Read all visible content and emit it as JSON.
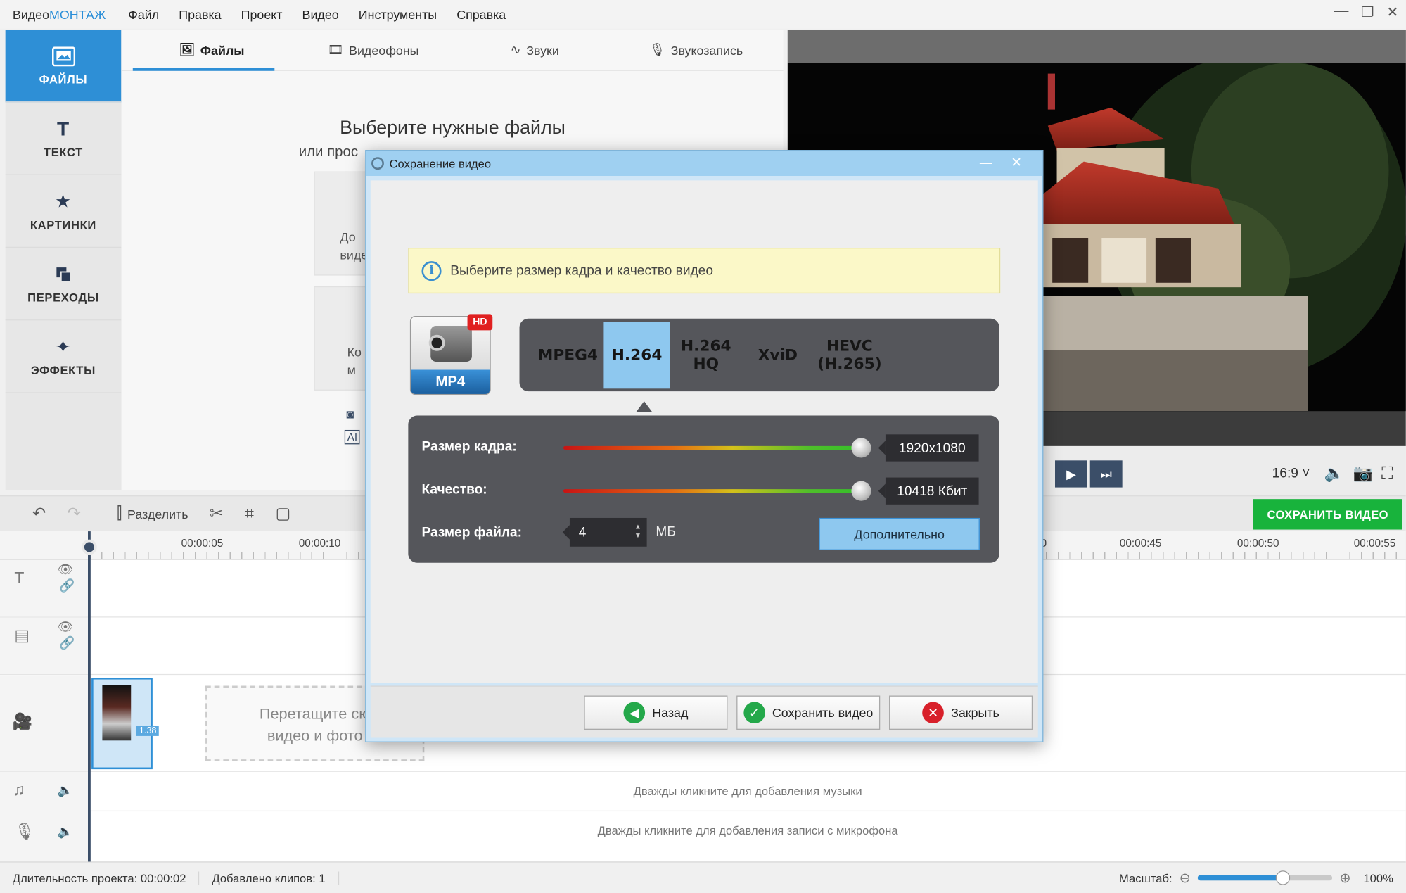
{
  "app": {
    "brand_prefix": "Видео",
    "brand_suffix": "МОНТАЖ"
  },
  "menu": [
    "Файл",
    "Правка",
    "Проект",
    "Видео",
    "Инструменты",
    "Справка"
  ],
  "sidebar": {
    "items": [
      {
        "label": "ФАЙЛЫ",
        "icon": "files-icon"
      },
      {
        "label": "ТЕКСТ",
        "icon": "text-icon"
      },
      {
        "label": "КАРТИНКИ",
        "icon": "star-icon"
      },
      {
        "label": "ПЕРЕХОДЫ",
        "icon": "transitions-icon"
      },
      {
        "label": "ЭФФЕКТЫ",
        "icon": "magic-wand-icon"
      }
    ]
  },
  "library": {
    "tabs": [
      "Файлы",
      "Видеофоны",
      "Звуки",
      "Звукозапись"
    ],
    "title": "Выберите нужные файлы",
    "subtitle": "или прос",
    "card1": "До\nвиде",
    "card2": "Ко\nм"
  },
  "preview": {
    "aspect": "16:9"
  },
  "toolbar": {
    "split_label": "Разделить",
    "save_video": "СОХРАНИТЬ ВИДЕО"
  },
  "ruler": {
    "times": [
      "00:00:05",
      "00:00:10",
      "0",
      "00:00:45",
      "00:00:50",
      "00:00:55"
    ]
  },
  "tracks": {
    "clip_duration": "1.38",
    "drop_hint": "Перетащите сю\nвидео и фото",
    "music_hint": "Дважды кликните для добавления музыки",
    "mic_hint": "Дважды кликните для добавления записи с микрофона"
  },
  "status": {
    "duration_label": "Длительность проекта:",
    "duration_value": "00:00:02",
    "clips_label": "Добавлено клипов:",
    "clips_value": "1",
    "zoom_label": "Масштаб:",
    "zoom_value": "100%",
    "zoom_level": 0.65
  },
  "dialog": {
    "title": "Сохранение видео",
    "info": "Выберите размер кадра и качество видео",
    "format": "MP4",
    "hd_badge": "HD",
    "codecs": [
      "MPEG4",
      "H.264",
      "H.264\nHQ",
      "XviD",
      "HEVC\n(H.265)"
    ],
    "selected_codec": "H.264",
    "frame_size_label": "Размер кадра:",
    "frame_size_value": "1920x1080",
    "frame_size_level": 1.0,
    "quality_label": "Качество:",
    "quality_value": "10418 Кбит",
    "quality_level": 1.0,
    "filesize_label": "Размер файла:",
    "filesize_value": "4",
    "filesize_unit": "МБ",
    "advanced_button": "Дополнительно",
    "back_button": "Назад",
    "save_button": "Сохранить видео",
    "close_button": "Закрыть"
  },
  "colors": {
    "accent": "#2e8fd6",
    "save_green": "#18b33c",
    "selected_codec": "#8ec8ef"
  }
}
